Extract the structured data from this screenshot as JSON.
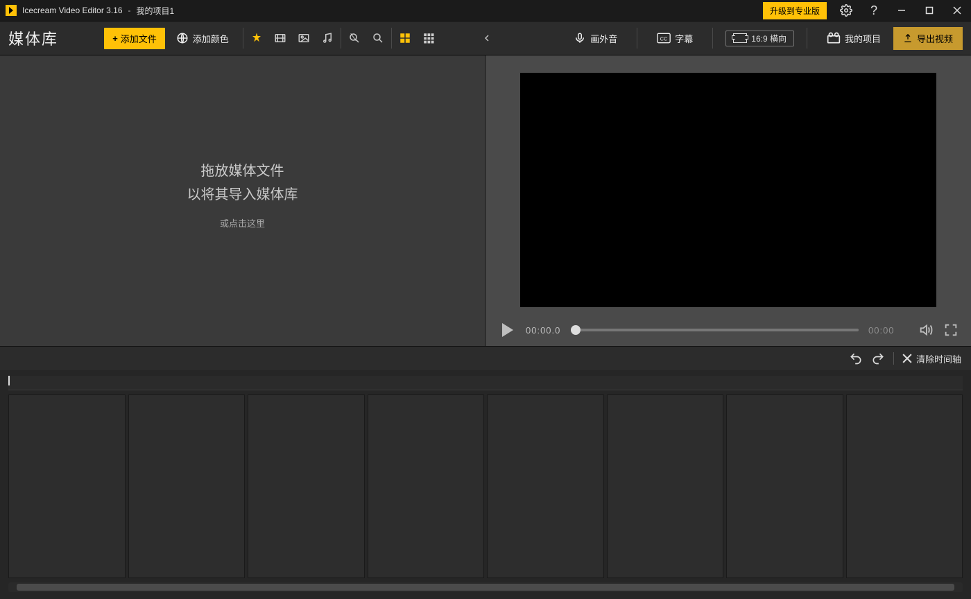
{
  "titlebar": {
    "app_title": "Icecream Video Editor 3.16",
    "separator": "-",
    "project_name": "我的项目1",
    "upgrade_label": "升级到专业版"
  },
  "toolbar_left": {
    "section_title": "媒体库",
    "add_file_label": "添加文件",
    "add_color_label": "添加颜色"
  },
  "media_drop": {
    "line1": "拖放媒体文件",
    "line2": "以将其导入媒体库",
    "line3": "或点击这里"
  },
  "toolbar_right": {
    "voiceover_label": "画外音",
    "subtitle_label": "字幕",
    "aspect_label": "16:9 横向",
    "my_projects_label": "我的项目",
    "export_label": "导出视频"
  },
  "preview": {
    "current_time": "00:00.0",
    "total_time": "00:00"
  },
  "timeline_bar": {
    "clear_label": "清除时间轴"
  },
  "timeline": {
    "slot_count": 8
  }
}
